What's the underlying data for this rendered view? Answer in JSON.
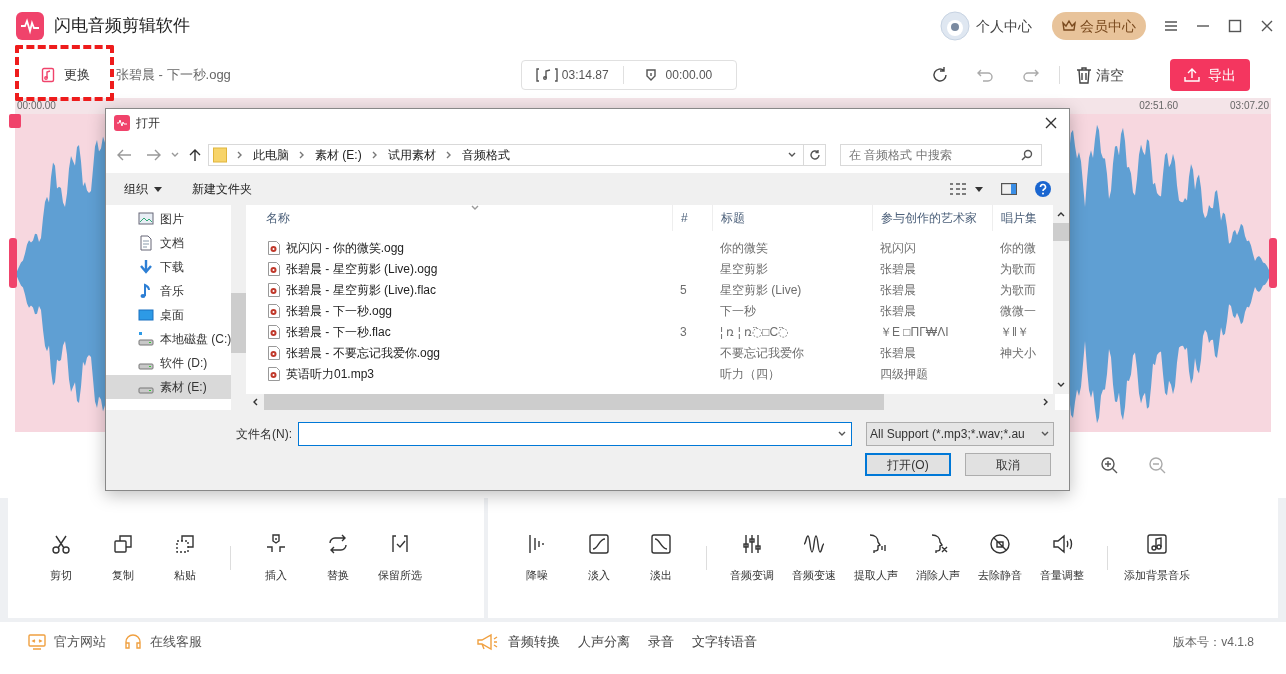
{
  "app": {
    "title": "闪电音频剪辑软件",
    "user_label": "个人中心",
    "vip_label": "会员中心"
  },
  "toolbar": {
    "replace_label": "更换",
    "highlighted": true,
    "file_name": "张碧晨 - 下一秒.ogg",
    "duration": "03:14.87",
    "position": "00:00.00",
    "clear_label": "清空",
    "export_label": "导出"
  },
  "timeline": {
    "ticks": [
      "00:00.00",
      "02:51.60",
      "03:07.20"
    ]
  },
  "tools": {
    "left": [
      [
        "剪切",
        "复制",
        "粘贴"
      ],
      [
        "插入",
        "替换",
        "保留所选"
      ]
    ],
    "right": [
      [
        "降噪",
        "淡入",
        "淡出"
      ],
      [
        "音频变调",
        "音频变速",
        "提取人声",
        "消除人声",
        "去除静音",
        "音量调整"
      ],
      [
        "添加背景音乐"
      ]
    ]
  },
  "footer": {
    "links": [
      "官方网站",
      "在线客服"
    ],
    "features": [
      "音频转换",
      "人声分离",
      "录音",
      "文字转语音"
    ],
    "version": "版本号：v4.1.8"
  },
  "dialog": {
    "title": "打开",
    "path": [
      "此电脑",
      "素材 (E:)",
      "试用素材",
      "音频格式"
    ],
    "search_placeholder": "在 音频格式 中搜索",
    "commands": [
      "组织",
      "新建文件夹"
    ],
    "nav": [
      {
        "label": "图片",
        "kind": "pictures",
        "selected": false
      },
      {
        "label": "文档",
        "kind": "documents",
        "selected": false
      },
      {
        "label": "下载",
        "kind": "downloads",
        "selected": false
      },
      {
        "label": "音乐",
        "kind": "music",
        "selected": false
      },
      {
        "label": "桌面",
        "kind": "desktop",
        "selected": false
      },
      {
        "label": "本地磁盘 (C:)",
        "kind": "system-drive",
        "selected": false
      },
      {
        "label": "软件 (D:)",
        "kind": "drive",
        "selected": false
      },
      {
        "label": "素材 (E:)",
        "kind": "drive",
        "selected": true
      }
    ],
    "columns": [
      "名称",
      "#",
      "标题",
      "参与创作的艺术家",
      "唱片集"
    ],
    "rows": [
      {
        "name": "祝闪闪 - 你的微笑.ogg",
        "title": "你的微笑",
        "artist": "祝闪闪",
        "album": "你的微"
      },
      {
        "name": "张碧晨 - 星空剪影 (Live).ogg",
        "title": "星空剪影",
        "artist": "张碧晨",
        "album": "为歌而"
      },
      {
        "name": "张碧晨 - 星空剪影 (Live).flac",
        "number": "5",
        "title": "星空剪影 (Live)",
        "artist": "张碧晨",
        "album": "为歌而"
      },
      {
        "name": "张碧晨 - 下一秒.ogg",
        "title": "下一秒",
        "artist": "张碧晨",
        "album": "微微一"
      },
      {
        "name": "张碧晨 - 下一秒.flac",
        "number": "3",
        "title": "¦ ռ ¦ ռ߳□Ϲ߳",
        "artist": "￥Ε □ΠΓ₩ΛΙ",
        "album": "￥ǁ￥"
      },
      {
        "name": "张碧晨 - 不要忘记我爱你.ogg",
        "title": "不要忘记我爱你",
        "artist": "张碧晨",
        "album": "神犬小"
      },
      {
        "name": "英语听力01.mp3",
        "title": "听力（四）",
        "artist": "四级押题"
      }
    ],
    "file_name_label": "文件名(N):",
    "filter": "All Support (*.mp3;*.wav;*.au",
    "open_button": "打开(O)",
    "cancel_button": "取消"
  }
}
